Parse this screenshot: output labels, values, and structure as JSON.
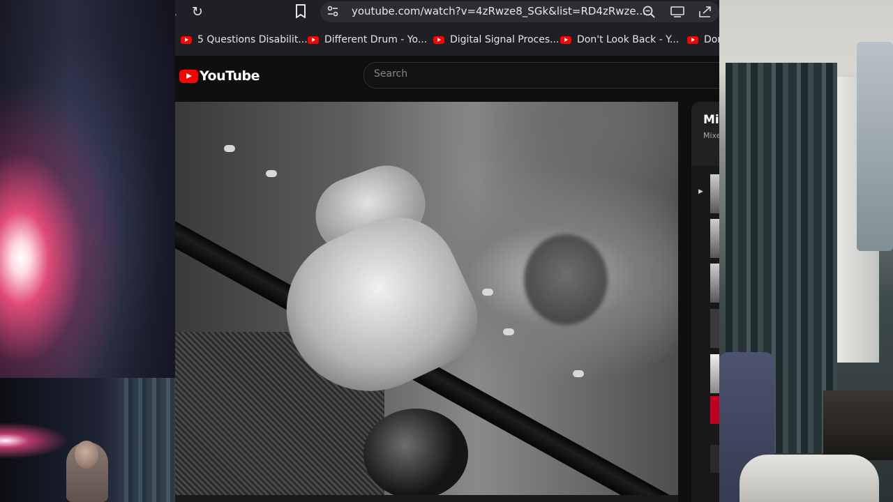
{
  "browser": {
    "url": "youtube.com/watch?v=4zRwze8_SGk&list=RD4zRwze...",
    "bookmarks": [
      {
        "label": "5 Questions Disabilit..."
      },
      {
        "label": "Different Drum - Yo..."
      },
      {
        "label": "Digital Signal Proces..."
      },
      {
        "label": "Don't Look Back - Y..."
      },
      {
        "label": "Dor"
      }
    ],
    "icons": {
      "reload": "reload-icon",
      "bookmark": "bookmark-icon",
      "site_info": "site-info-icon",
      "zoom": "zoom-icon",
      "install": "install-app-icon",
      "share": "share-icon"
    }
  },
  "youtube": {
    "logo_text": "YouTube",
    "search_placeholder": "Search",
    "accent": "#ff0000"
  },
  "playlist_panel": {
    "title": "Mi",
    "subtitle": "Mixe"
  }
}
